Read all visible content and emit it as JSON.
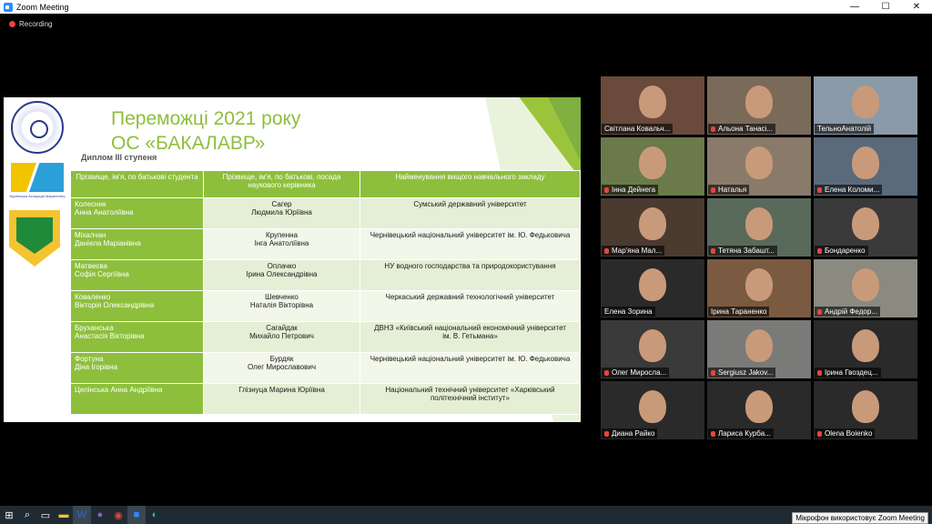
{
  "window": {
    "title": "Zoom Meeting",
    "minimize": "—",
    "maximize": "☐",
    "close": "✕"
  },
  "recording": {
    "label": "Recording"
  },
  "slide": {
    "title_line1": "Переможці 2021 року",
    "title_line2": "ОС «БАКАЛАВР»",
    "subtitle": "Диплом ІІІ ступеня",
    "logo_caption": "Українська Асоціація Маркетингу",
    "headers": [
      "Прізвище, ім'я, по батькові студента",
      "Прізвище, ім'я, по батькові, посада наукового керівника",
      "Найменування вищого навчального закладу"
    ],
    "rows": [
      {
        "student": "Колесник\nАнна Анатоліївна",
        "supervisor": "Сагер\nЛюдмила Юріївна",
        "university": "Сумський державний університет"
      },
      {
        "student": "Міхалчан\nДаніела Маріанівна",
        "supervisor": "Крупенна\nІнга Анатоліївна",
        "university": "Чернівецький національний університет ім. Ю. Федьковича"
      },
      {
        "student": "Матвеєва\nСофія Сергіївна",
        "supervisor": "Оплачко\nІрина Олександрівна",
        "university": "НУ водного господарства та природокористування"
      },
      {
        "student": "Коваленко\nВікторія Олександрівна",
        "supervisor": "Шевченко\nНаталія Вікторівна",
        "university": "Черкаський державний технологічний університет"
      },
      {
        "student": "Бруханська\nАнастасія Вікторівна",
        "supervisor": "Сагайдак\nМихайло Петрович",
        "university": "ДВНЗ «Київський національний економічний університет\nім. В. Гетьмана»"
      },
      {
        "student": "Фортуна\nДіна Ігорівна",
        "supervisor": "Бурдяк\nОлег Мирославович",
        "university": "Чернівецький національний університет ім. Ю. Федьковича"
      },
      {
        "student": "Целінська Анна Андріївна",
        "supervisor": "Глізнуца Марина Юріївна",
        "university": "Національний технічний університет «Харківський політехнічний інститут»"
      }
    ]
  },
  "participants": [
    {
      "name": "Світлана Ковальч...",
      "active": true,
      "muted": false,
      "bg": "#6a4a3a"
    },
    {
      "name": "Альона Танасі...",
      "active": false,
      "muted": true,
      "bg": "#7a6a5a"
    },
    {
      "name": "ТельноАнатолій",
      "active": false,
      "muted": false,
      "bg": "#8a9aa8"
    },
    {
      "name": "Інна Дейнега",
      "active": false,
      "muted": true,
      "bg": "#6a7a4a"
    },
    {
      "name": "Наталья",
      "active": false,
      "muted": true,
      "bg": "#8a7a6a"
    },
    {
      "name": "Елена Коломи...",
      "active": false,
      "muted": true,
      "bg": "#5a6a7a"
    },
    {
      "name": "Мар'яна Мал...",
      "active": false,
      "muted": true,
      "bg": "#4a3a30"
    },
    {
      "name": "Тетяна Забашт...",
      "active": false,
      "muted": true,
      "bg": "#5a6a5a"
    },
    {
      "name": "Бондаренко",
      "active": false,
      "muted": true,
      "bg": "#3a3a3a"
    },
    {
      "name": "Елена Зорина",
      "active": false,
      "muted": false,
      "bg": "#2a2a2a"
    },
    {
      "name": "Ірина Тараненко",
      "active": false,
      "muted": false,
      "bg": "#7a5a40"
    },
    {
      "name": "Андрій Федор...",
      "active": false,
      "muted": true,
      "bg": "#8a8a80"
    },
    {
      "name": "Олег Миросла...",
      "active": false,
      "muted": true,
      "bg": "#3a3a3a"
    },
    {
      "name": "Sergiusz Jakov...",
      "active": false,
      "muted": true,
      "bg": "#7a7a78"
    },
    {
      "name": "Ірина Гвоздец...",
      "active": false,
      "muted": true,
      "bg": "#2a2a2a"
    },
    {
      "name": "Диана Райко",
      "active": false,
      "muted": true,
      "bg": "#2a2a2a"
    },
    {
      "name": "Лариса Курба...",
      "active": false,
      "muted": true,
      "bg": "#2a2a2a"
    },
    {
      "name": "Olena Boienko",
      "active": false,
      "muted": true,
      "bg": "#2a2a2a"
    }
  ],
  "taskbar": {
    "items": [
      "start",
      "search",
      "task-view",
      "explorer",
      "word",
      "viber",
      "chrome",
      "zoom",
      "edge"
    ]
  },
  "notification": {
    "text": "Мікрофон використовує Zoom Meeting"
  }
}
